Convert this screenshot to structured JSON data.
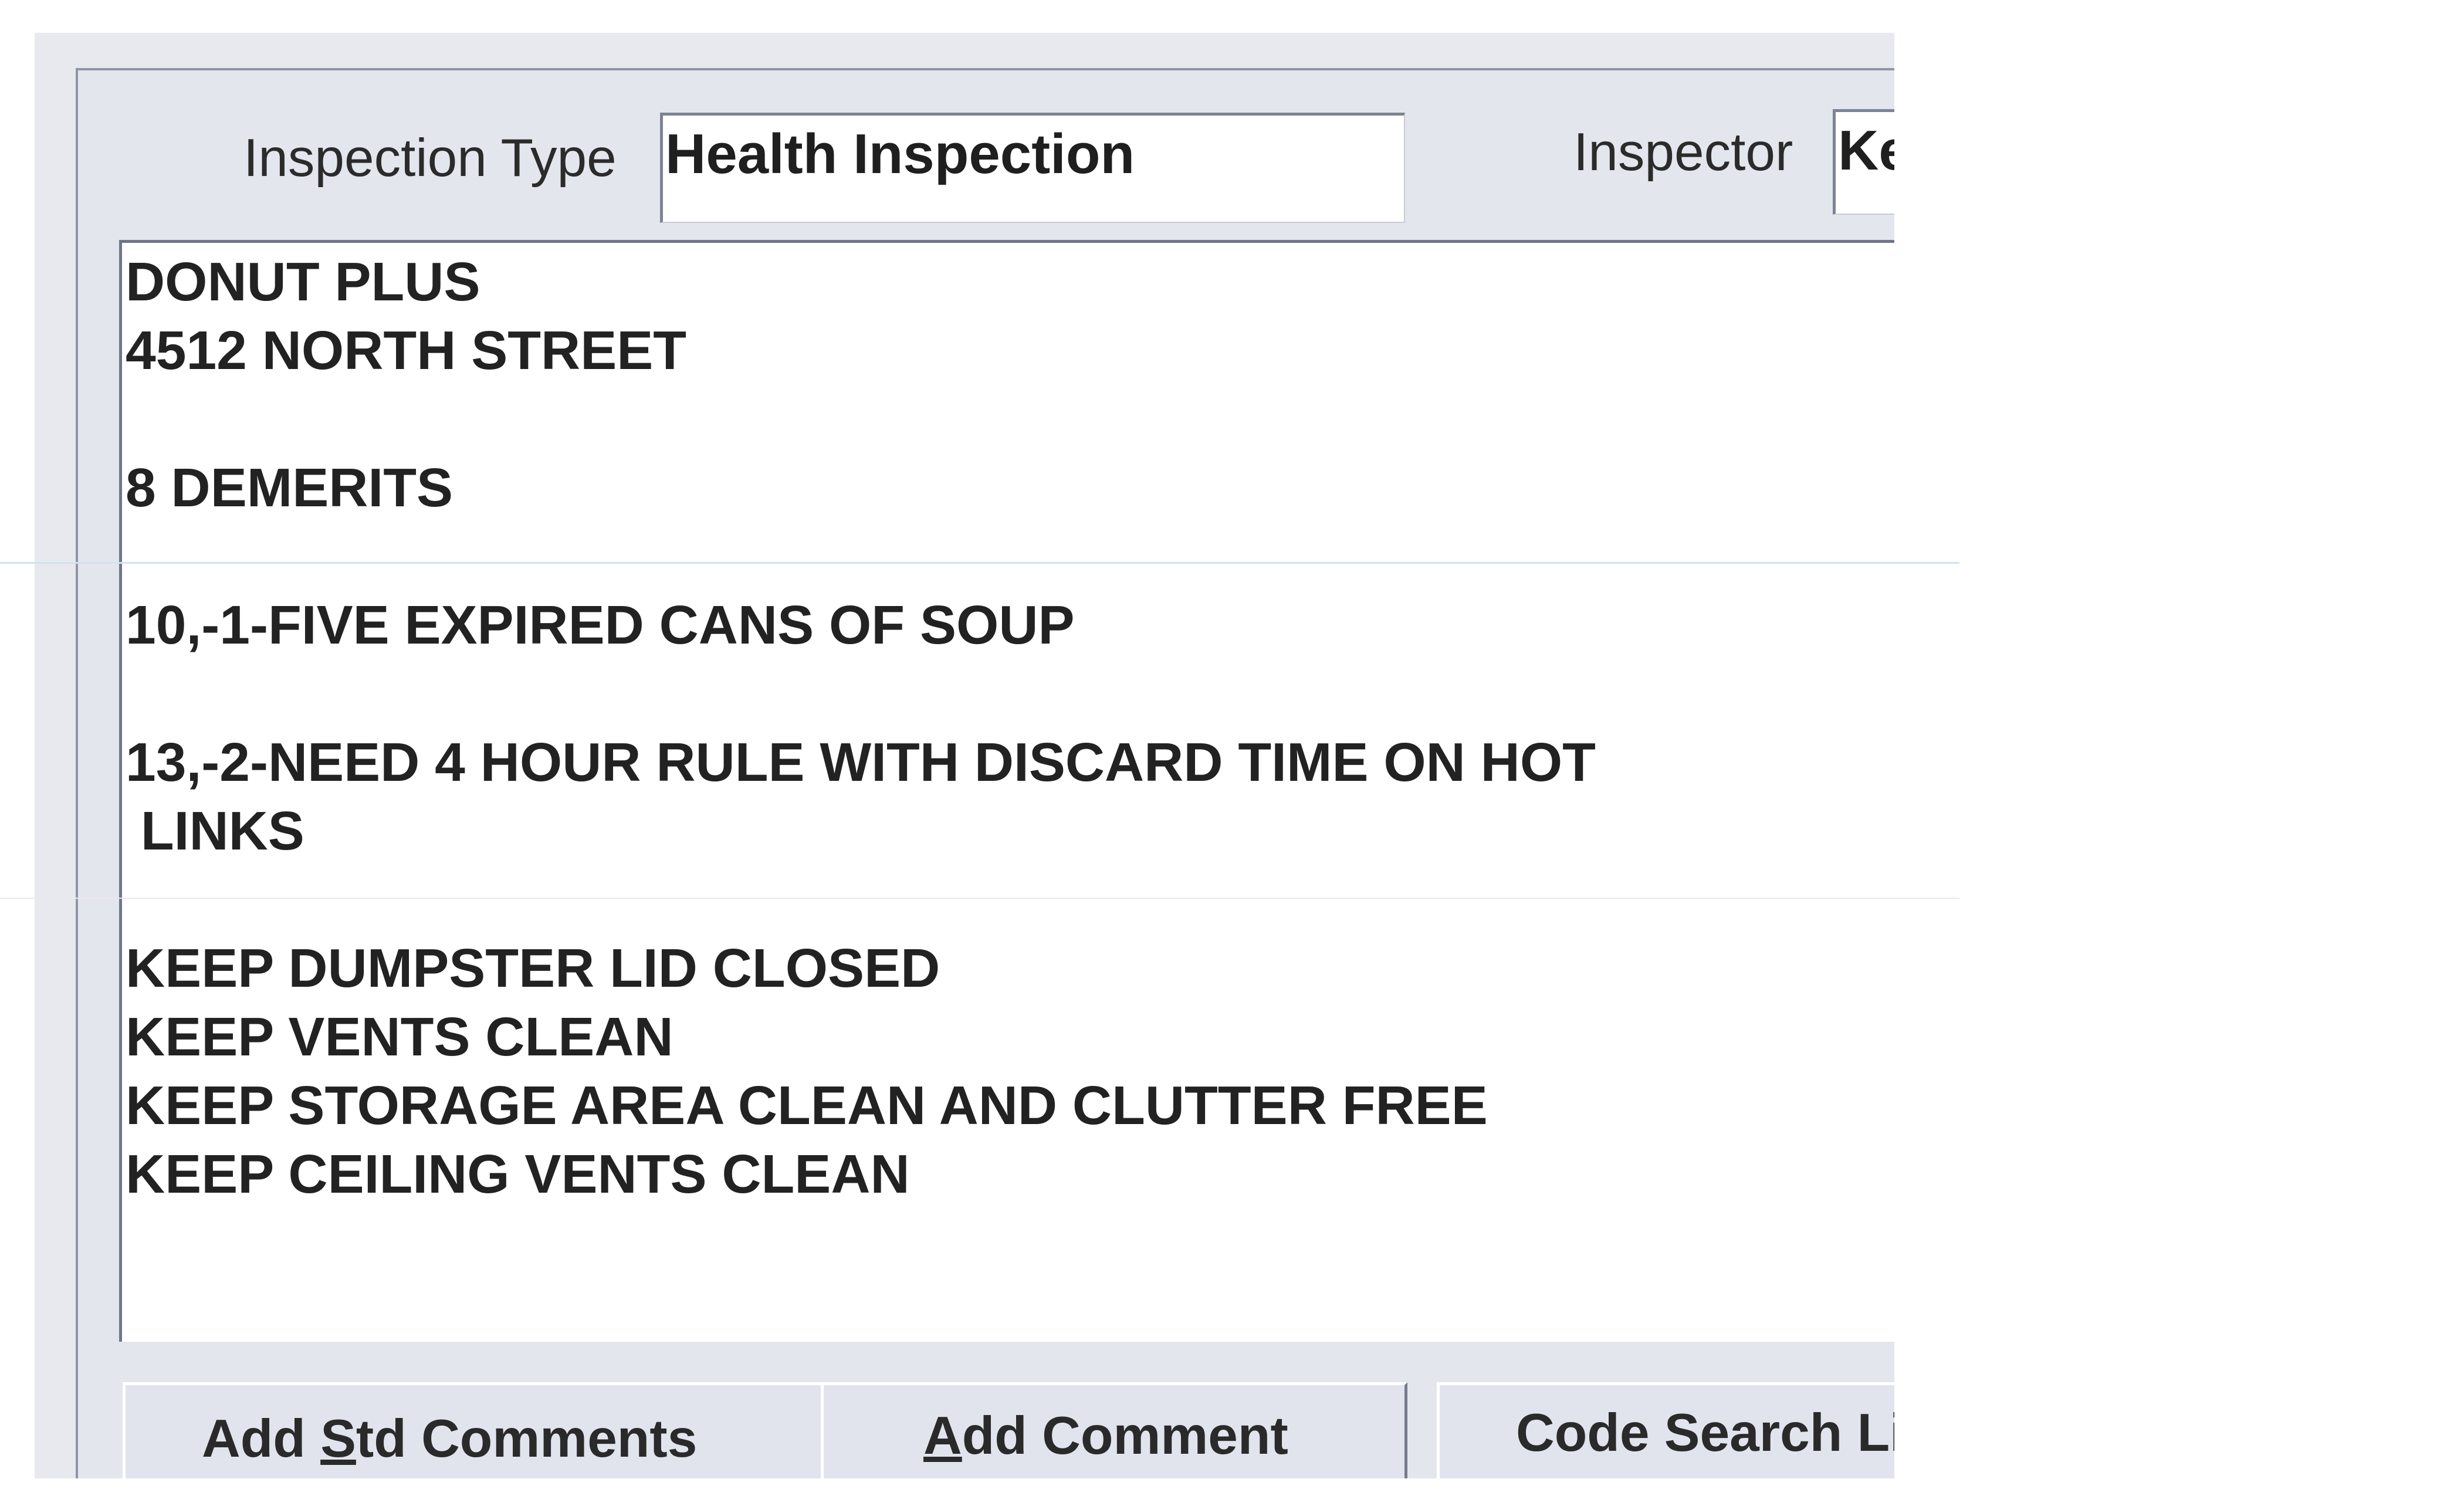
{
  "form": {
    "inspection_type_label": "Inspection Type",
    "inspection_type_value": "Health Inspection",
    "inspector_label": "Inspector",
    "inspector_value": "Ke"
  },
  "comments": {
    "lines": [
      "DONUT PLUS",
      "4512 NORTH STREET",
      "",
      "8 DEMERITS",
      "",
      "10,-1-FIVE EXPIRED CANS OF SOUP",
      "",
      "13,-2-NEED 4 HOUR RULE WITH DISCARD TIME ON HOT",
      " LINKS",
      "",
      "KEEP DUMPSTER LID CLOSED",
      "KEEP VENTS CLEAN",
      "KEEP STORAGE AREA CLEAN AND CLUTTER FREE",
      "KEEP CEILING VENTS CLEAN"
    ]
  },
  "buttons": {
    "add_std_comments_pre": "Add ",
    "add_std_comments_mnemonic": "S",
    "add_std_comments_post": "td Comments",
    "add_comment_mnemonic": "A",
    "add_comment_post": "dd Comment",
    "code_search": "Code Search Li"
  }
}
